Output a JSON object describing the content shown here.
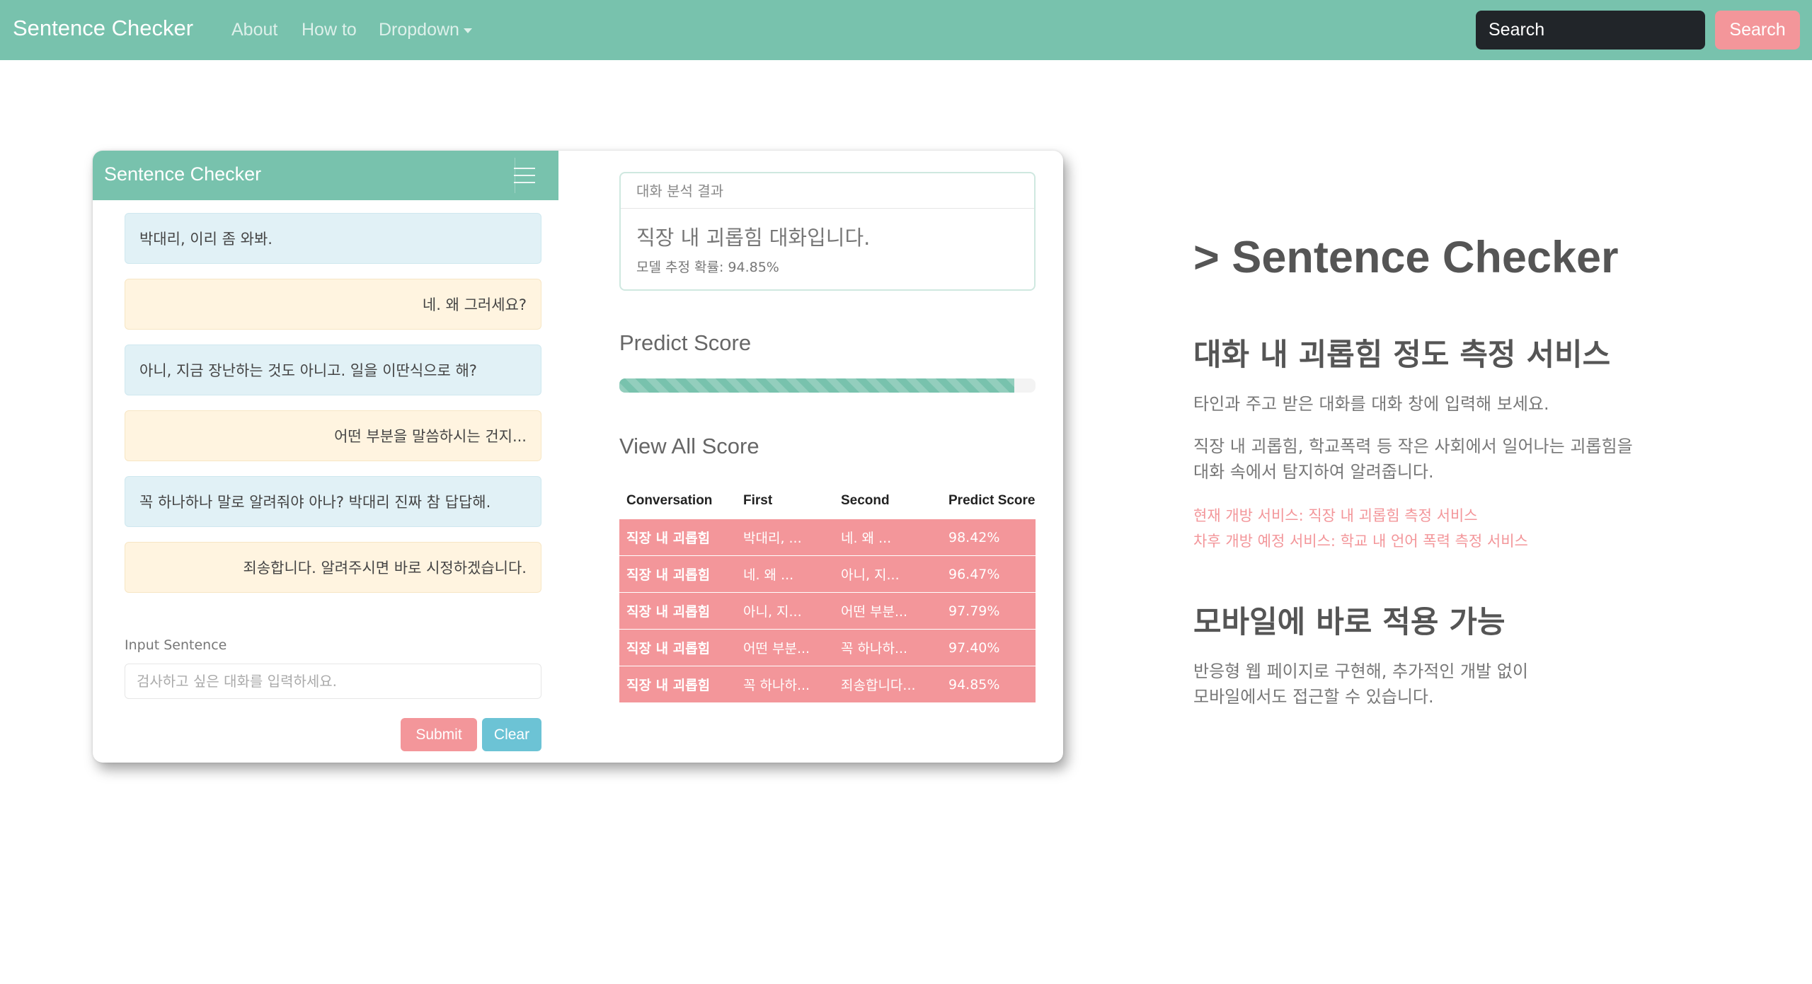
{
  "navbar": {
    "brand": "Sentence Checker",
    "links": [
      "About",
      "How to",
      "Dropdown"
    ],
    "search_placeholder": "Search",
    "search_button": "Search"
  },
  "chat": {
    "title": "Sentence Checker",
    "messages": [
      {
        "side": "left",
        "text": "박대리, 이리 좀 와봐."
      },
      {
        "side": "right",
        "text": "네. 왜 그러세요?"
      },
      {
        "side": "left",
        "text": "아니, 지금 장난하는 것도 아니고. 일을 이딴식으로 해?"
      },
      {
        "side": "right",
        "text": "어떤 부분을 말씀하시는 건지..."
      },
      {
        "side": "left",
        "text": "꼭 하나하나 말로 알려줘야 아나? 박대리 진짜 참 답답해."
      },
      {
        "side": "right",
        "text": "죄송합니다. 알려주시면 바로 시정하겠습니다."
      }
    ],
    "input_label": "Input Sentence",
    "input_placeholder": "검사하고 싶은 대화를 입력하세요.",
    "submit_label": "Submit",
    "clear_label": "Clear"
  },
  "result": {
    "header": "대화 분석 결과",
    "main": "직장 내 괴롭힘 대화입니다.",
    "probability": "모델 추정 확률: 94.85%"
  },
  "predict": {
    "title": "Predict Score",
    "progress": 0.9485
  },
  "scores": {
    "title": "View All Score",
    "columns": [
      "Conversation",
      "First",
      "Second",
      "Predict Score"
    ],
    "rows": [
      [
        "직장 내 괴롭힘",
        "박대리, ...",
        "네. 왜 ...",
        "98.42%"
      ],
      [
        "직장 내 괴롭힘",
        "네. 왜 ...",
        "아니, 지...",
        "96.47%"
      ],
      [
        "직장 내 괴롭힘",
        "아니, 지...",
        "어떤 부분...",
        "97.79%"
      ],
      [
        "직장 내 괴롭힘",
        "어떤 부분...",
        "꼭 하나하...",
        "97.40%"
      ],
      [
        "직장 내 괴롭힘",
        "꼭 하나하...",
        "죄송합니다...",
        "94.85%"
      ]
    ]
  },
  "side": {
    "heading": "> Sentence Checker",
    "section1_title": "대화 내 괴롭힘 정도 측정 서비스",
    "section1_p1": "타인과 주고 받은 대화를 대화 창에 입력해 보세요.",
    "section1_p2_line1": "직장 내 괴롭힘, 학교폭력 등 작은 사회에서 일어나는 괴롭힘을",
    "section1_p2_line2": "대화 속에서 탐지하여 알려줍니다.",
    "link1": "현재 개방 서비스: 직장 내 괴롭힘 측정 서비스",
    "link2": "차후 개방 예정 서비스: 학교 내 언어 폭력 측정 서비스",
    "section2_title": "모바일에 바로 적용 가능",
    "section2_line1": "반응형 웹 페이지로 구현해, 추가적인 개발 없이",
    "section2_line2": "모바일에서도 접근할 수 있습니다."
  },
  "colors": {
    "primary": "#78c2ad",
    "danger": "#f3969a",
    "info": "#6cc3d5",
    "dark": "#212529"
  }
}
